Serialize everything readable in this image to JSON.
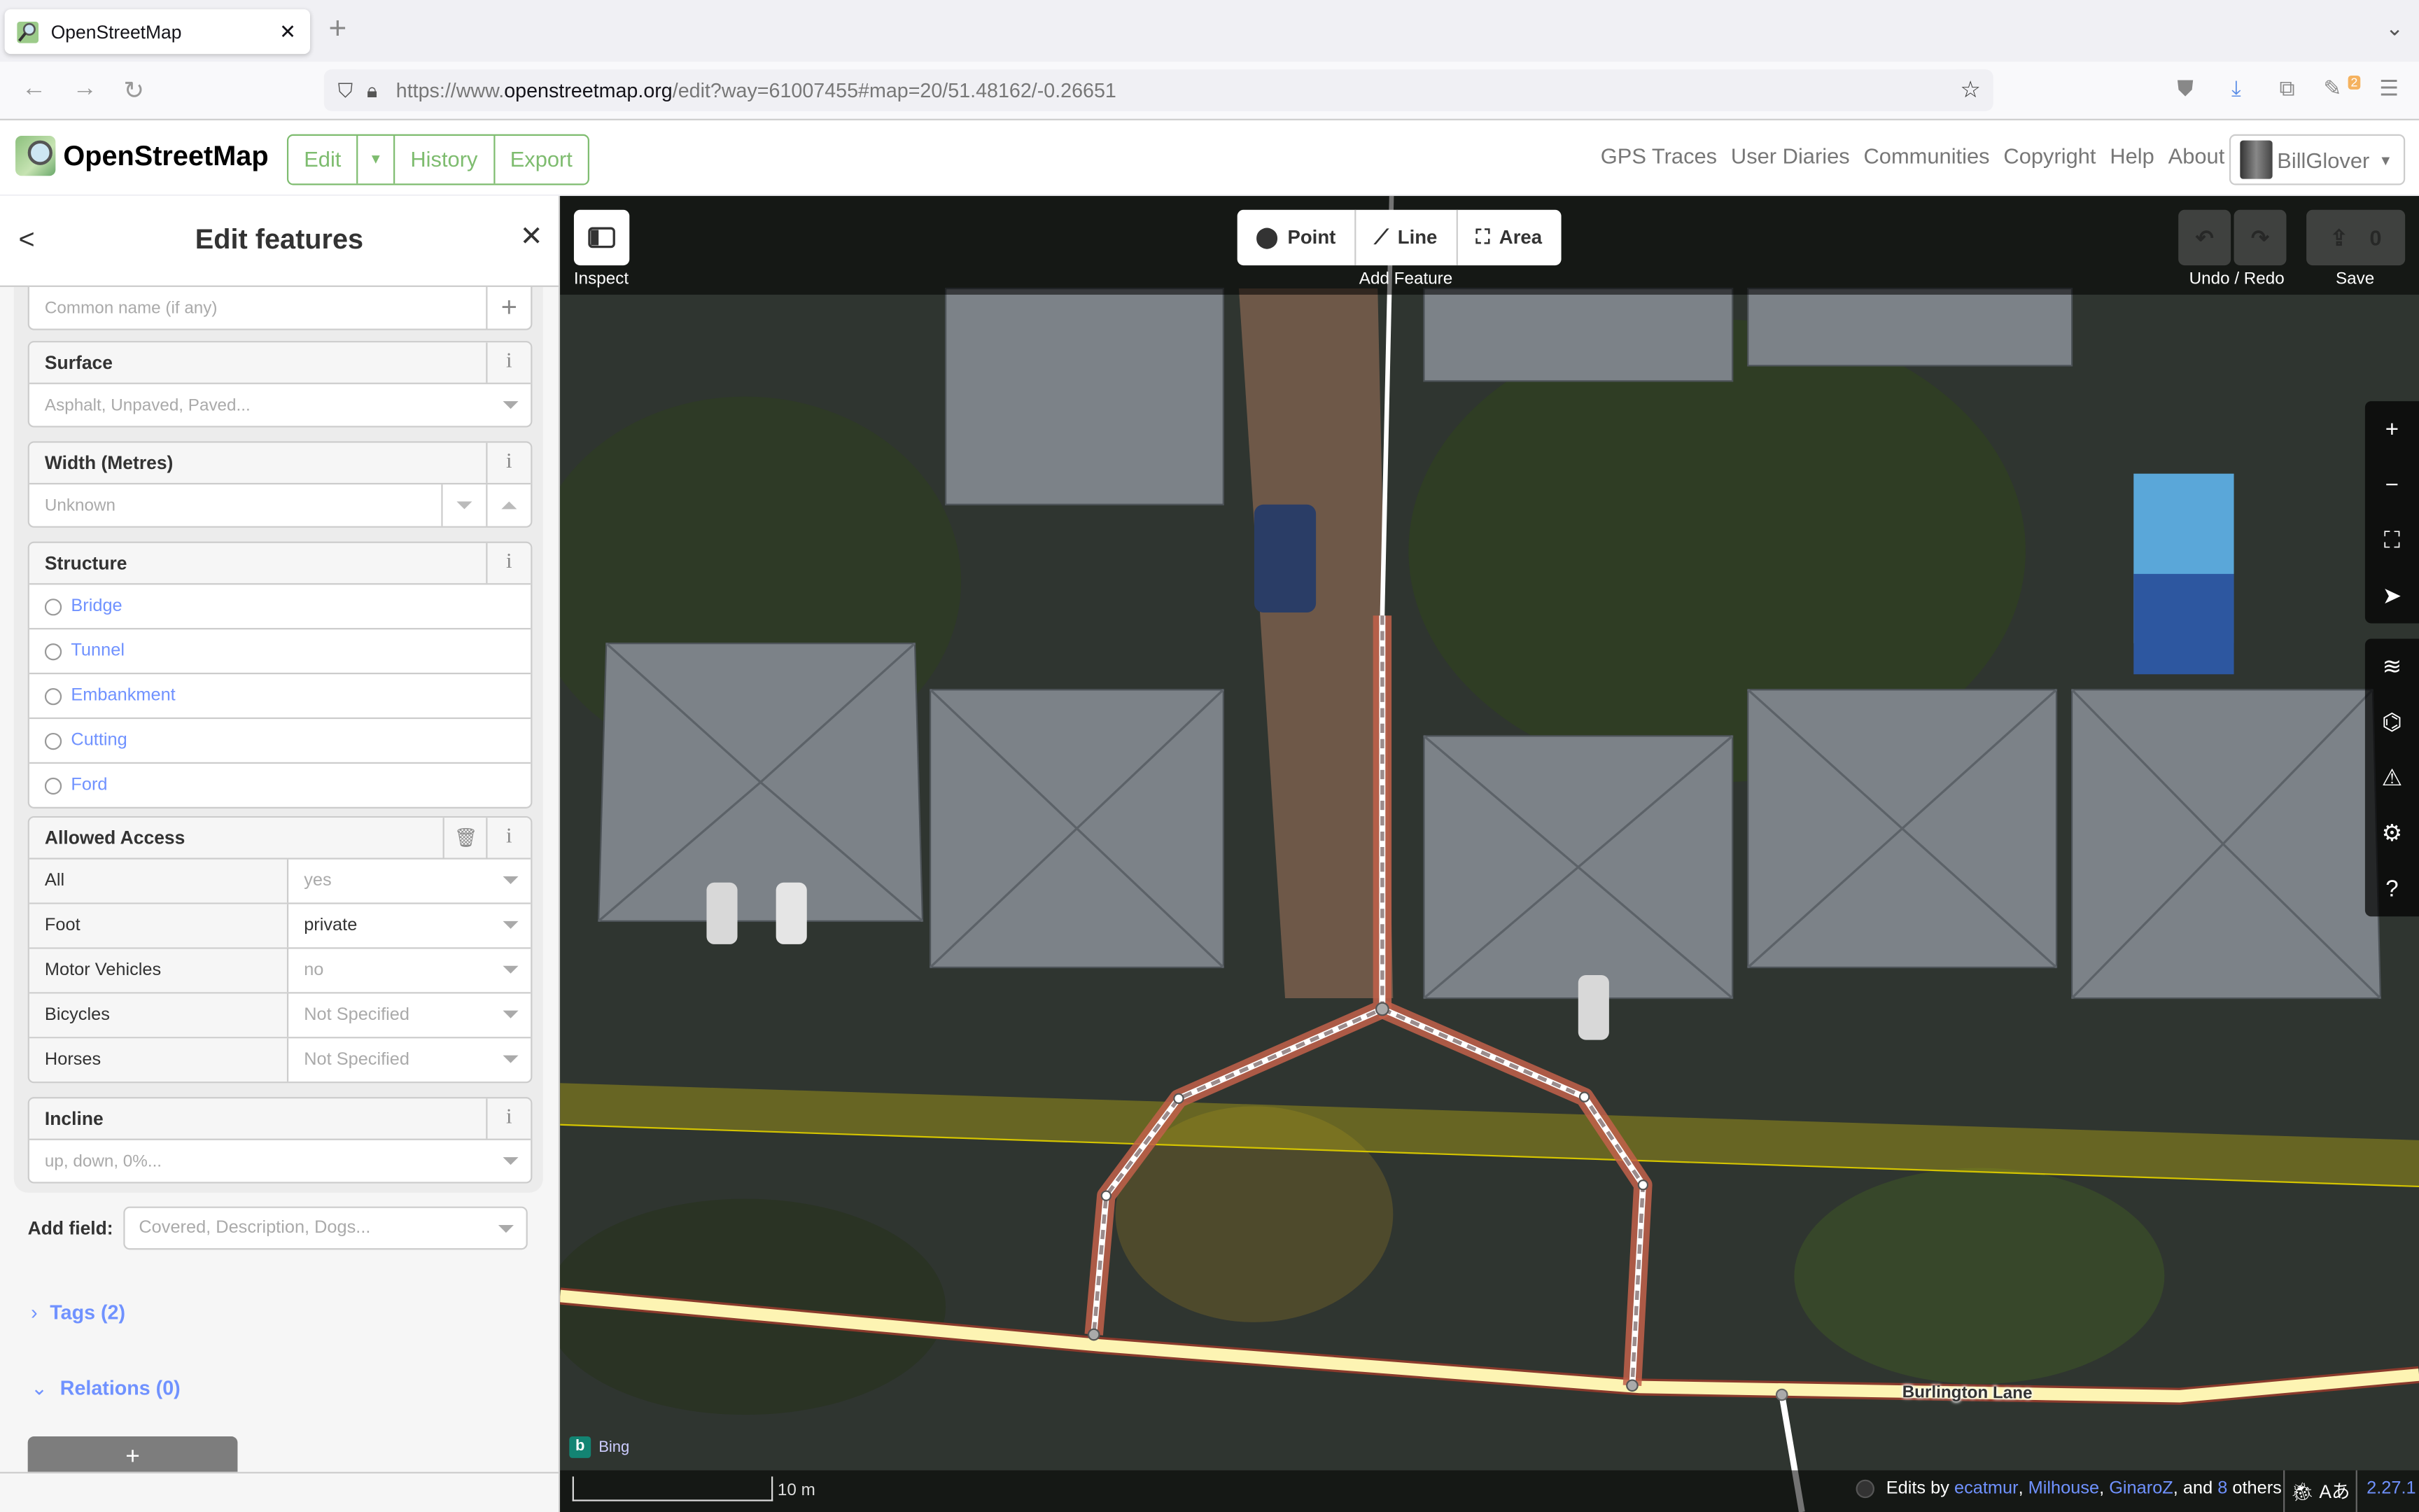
{
  "browser": {
    "tab_title": "OpenStreetMap",
    "url_prefix": "https://www.",
    "url_domain": "openstreetmap.org",
    "url_path": "/edit?way=61007455#map=20/51.48162/-0.26651",
    "extension_badge": "2"
  },
  "osm_header": {
    "brand": "OpenStreetMap",
    "buttons": {
      "edit": "Edit",
      "history": "History",
      "export": "Export"
    },
    "nav_links": [
      "GPS Traces",
      "User Diaries",
      "Communities",
      "Copyright",
      "Help",
      "About"
    ],
    "username": "BillGlover"
  },
  "sidebar": {
    "title": "Edit features",
    "name_field": {
      "placeholder": "Common name (if any)"
    },
    "surface": {
      "label": "Surface",
      "placeholder": "Asphalt, Unpaved, Paved..."
    },
    "width": {
      "label": "Width (Metres)",
      "placeholder": "Unknown"
    },
    "structure": {
      "label": "Structure",
      "options": [
        "Bridge",
        "Tunnel",
        "Embankment",
        "Cutting",
        "Ford"
      ]
    },
    "access": {
      "label": "Allowed Access",
      "rows": [
        {
          "key": "All",
          "value": "yes",
          "is_set": false
        },
        {
          "key": "Foot",
          "value": "private",
          "is_set": true
        },
        {
          "key": "Motor Vehicles",
          "value": "no",
          "is_set": false
        },
        {
          "key": "Bicycles",
          "value": "Not Specified",
          "is_set": false
        },
        {
          "key": "Horses",
          "value": "Not Specified",
          "is_set": false
        }
      ]
    },
    "incline": {
      "label": "Incline",
      "placeholder": "up, down, 0%..."
    },
    "add_field": {
      "label": "Add field:",
      "placeholder": "Covered, Description, Dogs..."
    },
    "tags_section": "Tags (2)",
    "relations_section": "Relations (0)",
    "add_relation": "+"
  },
  "map": {
    "toolbar": {
      "inspect_label": "Inspect",
      "add_feature_label": "Add Feature",
      "point": "Point",
      "line": "Line",
      "area": "Area",
      "undo_redo_label": "Undo / Redo",
      "save_label": "Save",
      "save_count": "0"
    },
    "road_label": "Burlington Lane",
    "imagery": "Bing",
    "scale_label": "10 m",
    "attribution": {
      "prefix": "Edits by ",
      "users": [
        "ecatmur",
        "Milhouse",
        "GinaroZ"
      ],
      "and": " and ",
      "others_count": "8",
      "others": " others"
    },
    "version": "2.27.1",
    "colors": {
      "selected_way": "#c2604a",
      "road_fill": "#fdf4b3",
      "accent": "#7092ff",
      "osm_green": "#7ebc6f"
    }
  }
}
